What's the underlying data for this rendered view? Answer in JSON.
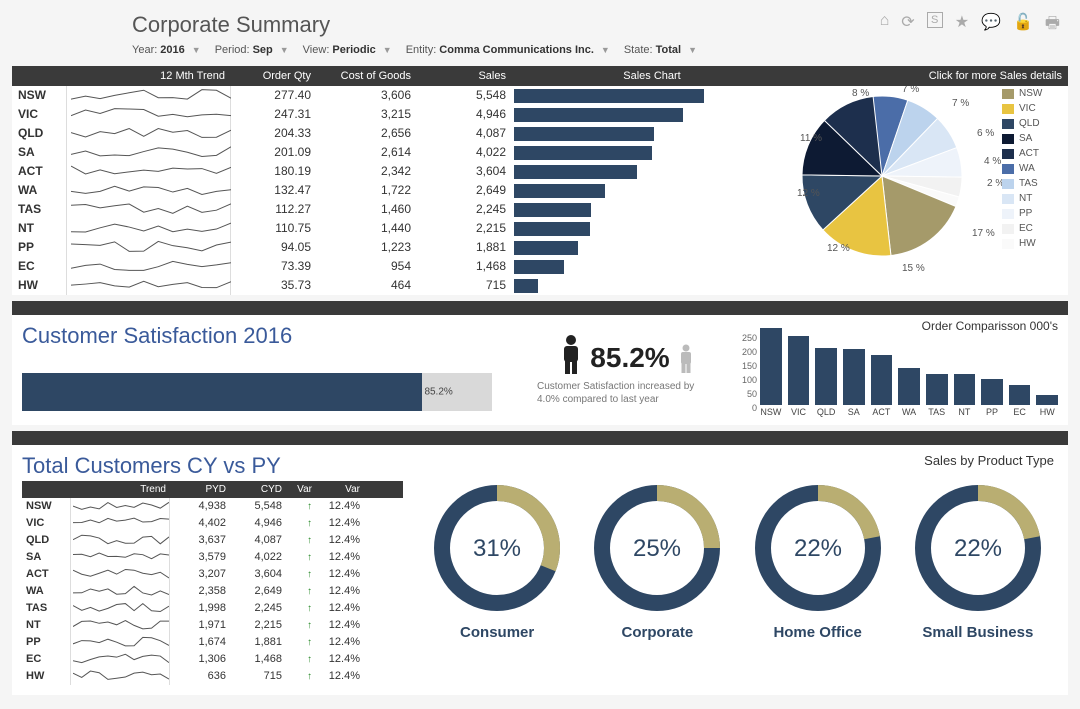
{
  "header": {
    "title": "Corporate Summary",
    "filters": {
      "year_label": "Year:",
      "year": "2016",
      "period_label": "Period:",
      "period": "Sep",
      "view_label": "View:",
      "view": "Periodic",
      "entity_label": "Entity:",
      "entity": "Comma Communications Inc.",
      "state_label": "State:",
      "state": "Total"
    }
  },
  "top_table": {
    "headers": {
      "trend": "12 Mth Trend",
      "qty": "Order Qty",
      "cost": "Cost of Goods",
      "sales": "Sales",
      "chart": "Sales Chart",
      "details": "Click for more Sales details"
    },
    "rows": [
      {
        "region": "NSW",
        "qty": "277.40",
        "cost": "3,606",
        "sales": "5,548"
      },
      {
        "region": "VIC",
        "qty": "247.31",
        "cost": "3,215",
        "sales": "4,946"
      },
      {
        "region": "QLD",
        "qty": "204.33",
        "cost": "2,656",
        "sales": "4,087"
      },
      {
        "region": "SA",
        "qty": "201.09",
        "cost": "2,614",
        "sales": "4,022"
      },
      {
        "region": "ACT",
        "qty": "180.19",
        "cost": "2,342",
        "sales": "3,604"
      },
      {
        "region": "WA",
        "qty": "132.47",
        "cost": "1,722",
        "sales": "2,649"
      },
      {
        "region": "TAS",
        "qty": "112.27",
        "cost": "1,460",
        "sales": "2,245"
      },
      {
        "region": "NT",
        "qty": "110.75",
        "cost": "1,440",
        "sales": "2,215"
      },
      {
        "region": "PP",
        "qty": "94.05",
        "cost": "1,223",
        "sales": "1,881"
      },
      {
        "region": "EC",
        "qty": "73.39",
        "cost": "954",
        "sales": "1,468"
      },
      {
        "region": "HW",
        "qty": "35.73",
        "cost": "464",
        "sales": "715"
      }
    ]
  },
  "pie": {
    "labels": [
      "8 %",
      "7 %",
      "7 %",
      "6 %",
      "4 %",
      "2 %",
      "17 %",
      "15 %",
      "12 %",
      "12 %",
      "11 %"
    ],
    "legend": [
      "NSW",
      "VIC",
      "QLD",
      "SA",
      "ACT",
      "WA",
      "TAS",
      "NT",
      "PP",
      "EC",
      "HW"
    ],
    "colors": [
      "#a59a6a",
      "#e8c441",
      "#2e4764",
      "#0d1a33",
      "#1d2f4d",
      "#4b6da8",
      "#bcd3ed",
      "#d9e6f5",
      "#eef3fa",
      "#f2f2f2",
      "#fafafa"
    ]
  },
  "satisfaction": {
    "title": "Customer Satisfaction 2016",
    "pct": "85.2%",
    "note": "Customer Satisfaction increased by 4.0% compared to last year"
  },
  "order_comp": {
    "title": "Order Comparisson 000's",
    "yticks": [
      "250",
      "200",
      "150",
      "100",
      "50",
      "0"
    ],
    "bars": [
      {
        "lbl": "NSW",
        "v": 277
      },
      {
        "lbl": "VIC",
        "v": 247
      },
      {
        "lbl": "QLD",
        "v": 204
      },
      {
        "lbl": "SA",
        "v": 201
      },
      {
        "lbl": "ACT",
        "v": 180
      },
      {
        "lbl": "WA",
        "v": 132
      },
      {
        "lbl": "TAS",
        "v": 112
      },
      {
        "lbl": "NT",
        "v": 111
      },
      {
        "lbl": "PP",
        "v": 94
      },
      {
        "lbl": "EC",
        "v": 73
      },
      {
        "lbl": "HW",
        "v": 36
      }
    ]
  },
  "bottom": {
    "title": "Total Customers CY vs PY",
    "right_title": "Sales by Product Type",
    "headers": {
      "trend": "Trend",
      "pyd": "PYD",
      "cyd": "CYD",
      "var_i": "Var",
      "var": "Var"
    },
    "rows": [
      {
        "region": "NSW",
        "pyd": "4,938",
        "cyd": "5,548",
        "var": "12.4%"
      },
      {
        "region": "VIC",
        "pyd": "4,402",
        "cyd": "4,946",
        "var": "12.4%"
      },
      {
        "region": "QLD",
        "pyd": "3,637",
        "cyd": "4,087",
        "var": "12.4%"
      },
      {
        "region": "SA",
        "pyd": "3,579",
        "cyd": "4,022",
        "var": "12.4%"
      },
      {
        "region": "ACT",
        "pyd": "3,207",
        "cyd": "3,604",
        "var": "12.4%"
      },
      {
        "region": "WA",
        "pyd": "2,358",
        "cyd": "2,649",
        "var": "12.4%"
      },
      {
        "region": "TAS",
        "pyd": "1,998",
        "cyd": "2,245",
        "var": "12.4%"
      },
      {
        "region": "NT",
        "pyd": "1,971",
        "cyd": "2,215",
        "var": "12.4%"
      },
      {
        "region": "PP",
        "pyd": "1,674",
        "cyd": "1,881",
        "var": "12.4%"
      },
      {
        "region": "EC",
        "pyd": "1,306",
        "cyd": "1,468",
        "var": "12.4%"
      },
      {
        "region": "HW",
        "pyd": "636",
        "cyd": "715",
        "var": "12.4%"
      }
    ],
    "donuts": [
      {
        "label": "Consumer",
        "pct": 31
      },
      {
        "label": "Corporate",
        "pct": 25
      },
      {
        "label": "Home Office",
        "pct": 22
      },
      {
        "label": "Small Business",
        "pct": 22
      }
    ]
  },
  "chart_data": [
    {
      "type": "bar",
      "title": "Sales Chart",
      "categories": [
        "NSW",
        "VIC",
        "QLD",
        "SA",
        "ACT",
        "WA",
        "TAS",
        "NT",
        "PP",
        "EC",
        "HW"
      ],
      "values": [
        5548,
        4946,
        4087,
        4022,
        3604,
        2649,
        2245,
        2215,
        1881,
        1468,
        715
      ],
      "orientation": "horizontal"
    },
    {
      "type": "pie",
      "title": "Click for more Sales details",
      "categories": [
        "NSW",
        "VIC",
        "QLD",
        "SA",
        "ACT",
        "WA",
        "TAS",
        "NT",
        "PP",
        "EC",
        "HW"
      ],
      "values": [
        17,
        15,
        12,
        12,
        11,
        8,
        7,
        7,
        6,
        4,
        2
      ]
    },
    {
      "type": "bar",
      "title": "Customer Satisfaction 2016",
      "categories": [
        "Satisfaction"
      ],
      "values": [
        85.2
      ],
      "xlim": [
        0,
        100
      ],
      "orientation": "horizontal"
    },
    {
      "type": "bar",
      "title": "Order Comparisson 000's",
      "categories": [
        "NSW",
        "VIC",
        "QLD",
        "SA",
        "ACT",
        "WA",
        "TAS",
        "NT",
        "PP",
        "EC",
        "HW"
      ],
      "values": [
        277,
        247,
        204,
        201,
        180,
        132,
        112,
        111,
        94,
        73,
        36
      ],
      "ylim": [
        0,
        280
      ]
    },
    {
      "type": "pie",
      "title": "Sales by Product Type",
      "categories": [
        "Consumer",
        "Corporate",
        "Home Office",
        "Small Business"
      ],
      "values": [
        31,
        25,
        22,
        22
      ]
    }
  ]
}
